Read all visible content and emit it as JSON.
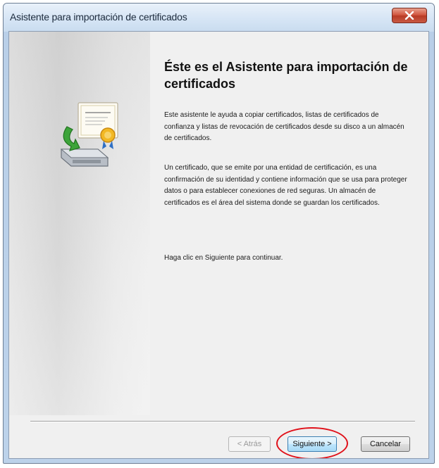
{
  "window": {
    "title": "Asistente para importación de certificados",
    "close_icon": "close-icon"
  },
  "side_panel": {
    "icon": "certificate-import-icon"
  },
  "content": {
    "heading": "Éste es el Asistente para importación de certificados",
    "paragraph_1": "Este asistente le ayuda a copiar certificados, listas de certificados de confianza y listas de revocación de certificados desde su disco a un almacén de certificados.",
    "paragraph_2": "Un certificado, que se emite por una entidad de certificación, es una confirmación de su identidad y contiene información que se usa para proteger datos o para establecer conexiones de red seguras. Un almacén de certificados es el área del sistema donde se guardan los certificados.",
    "paragraph_3": "Haga clic en Siguiente para continuar."
  },
  "buttons": {
    "back_label": "< Atrás",
    "next_label": "Siguiente >",
    "cancel_label": "Cancelar",
    "back_enabled": false
  },
  "annotation": {
    "highlight_color": "#e0111a"
  },
  "colors": {
    "titlebar": "#d6e5f5",
    "close_button": "#c85a44",
    "dialog_background": "#f0f0f0"
  }
}
